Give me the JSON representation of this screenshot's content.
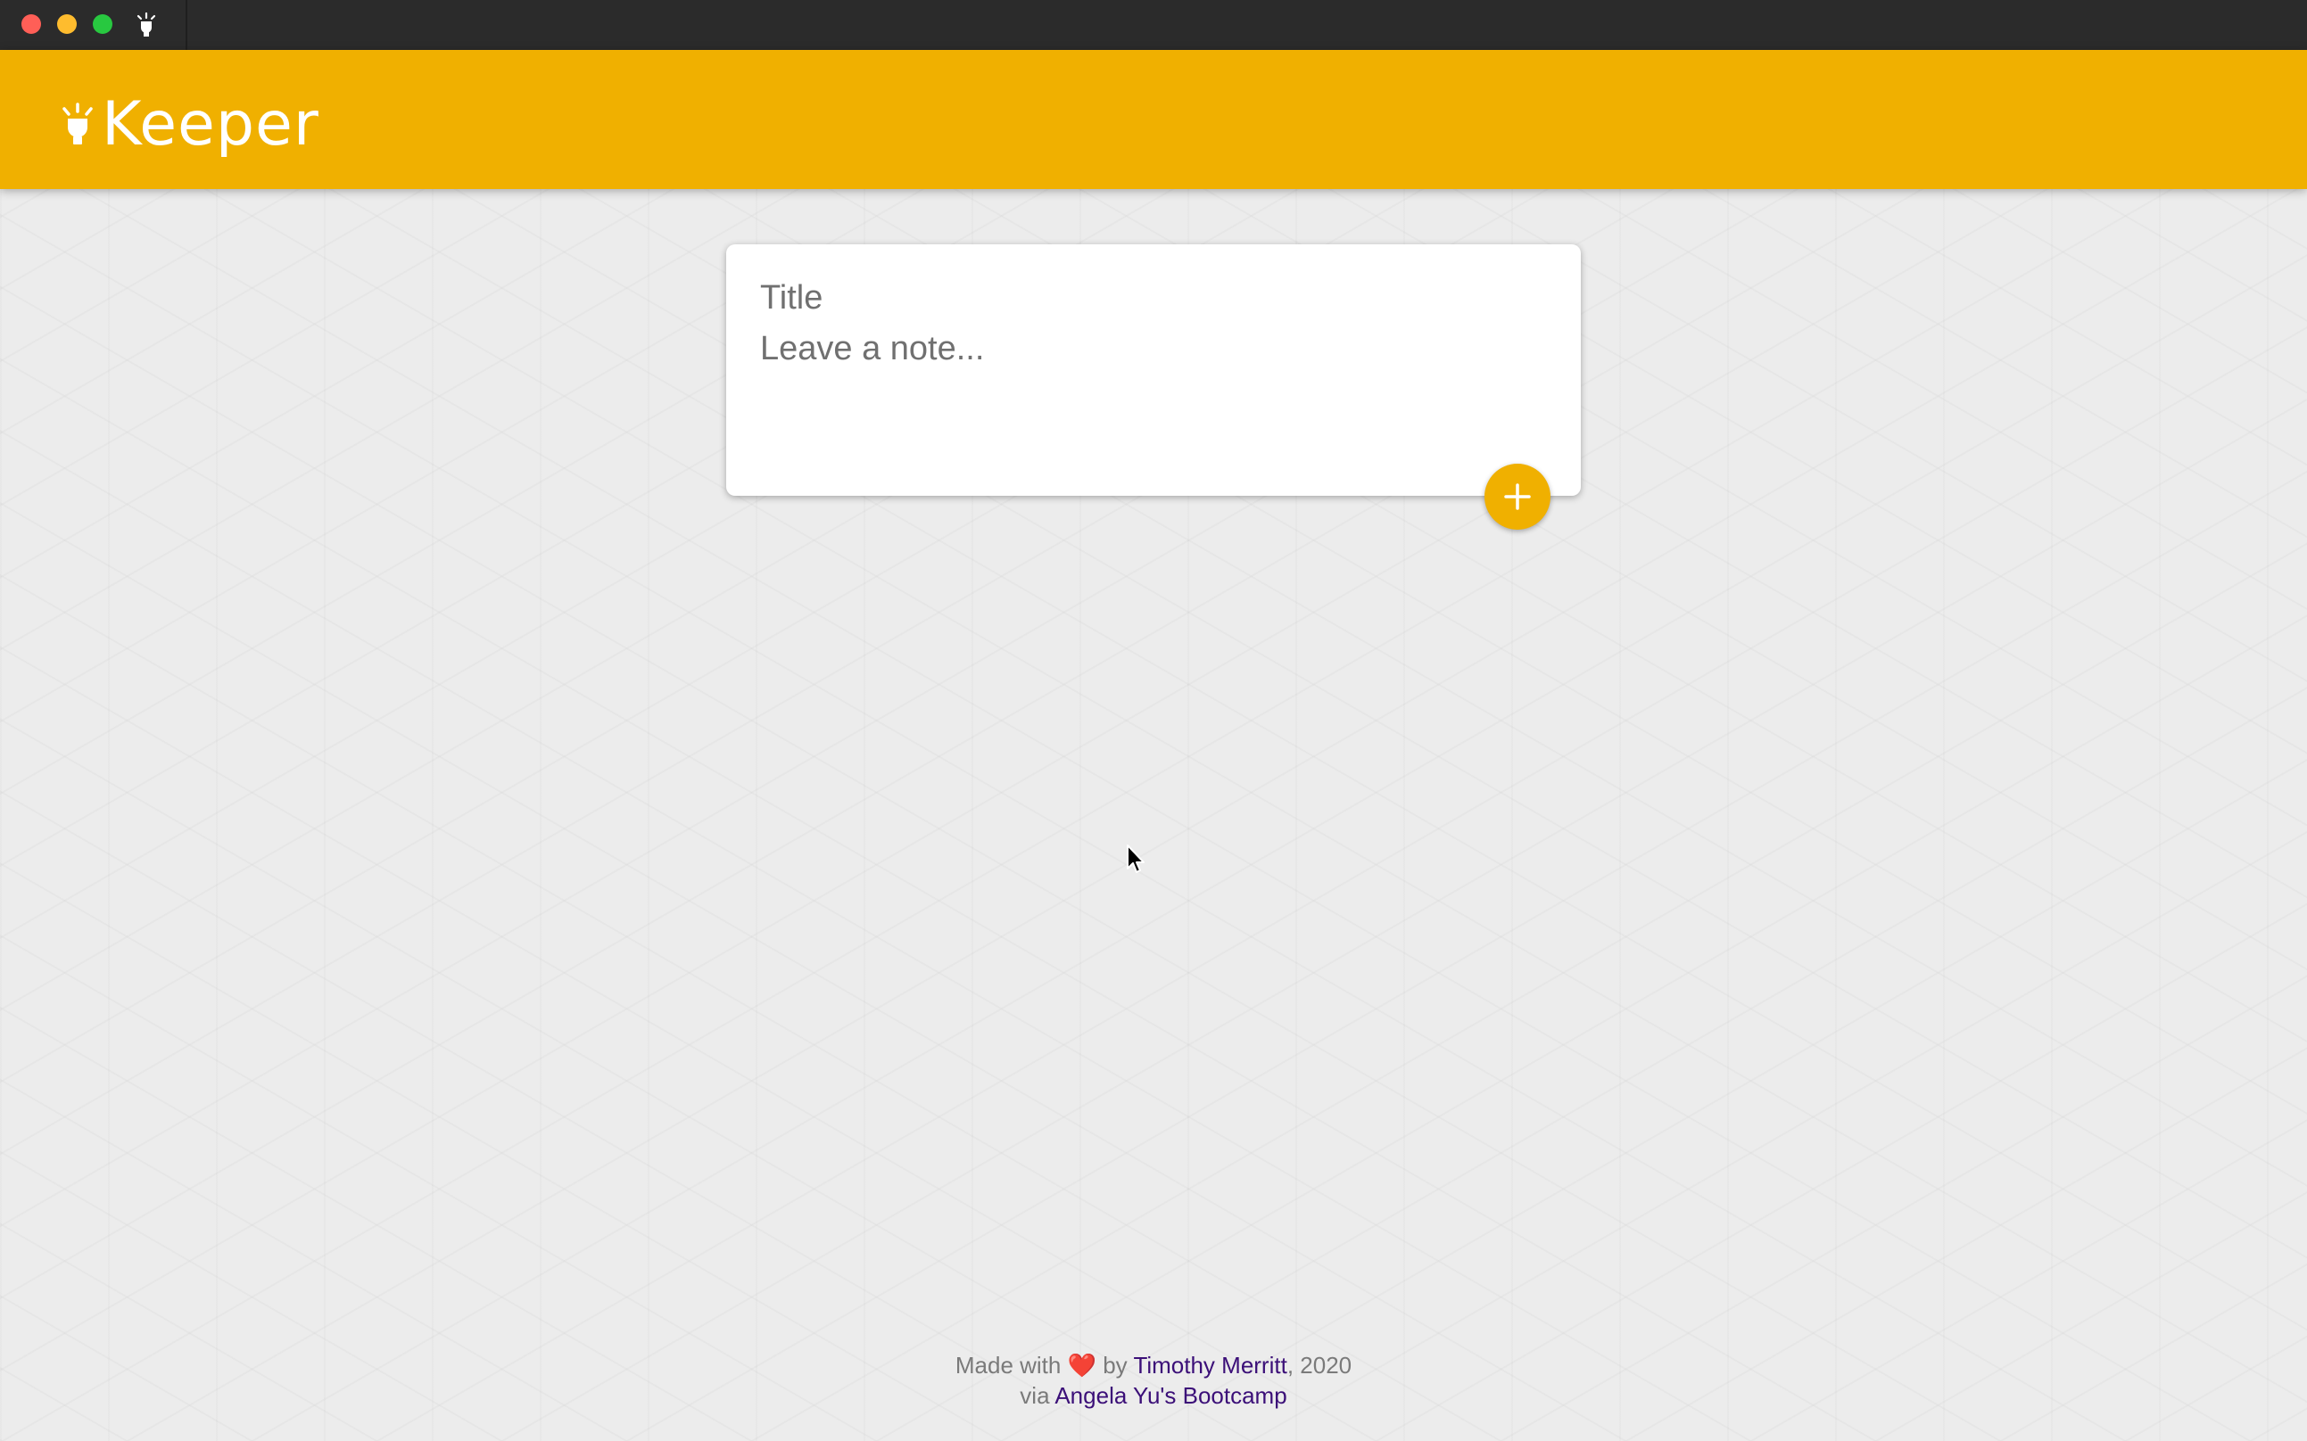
{
  "app": {
    "brand": "Keeper",
    "accent_color": "#f0b000",
    "brand_icon": "lightbulb-icon"
  },
  "composer": {
    "title_placeholder": "Title",
    "note_placeholder": "Leave a note...",
    "title_value": "",
    "note_value": "",
    "add_button_icon": "plus-icon"
  },
  "footer": {
    "made_with": "Made with",
    "heart": "❤️",
    "by": "by",
    "author": "Timothy Merritt",
    "year": ", 2020",
    "via": "via",
    "course": "Angela Yu's Bootcamp"
  }
}
